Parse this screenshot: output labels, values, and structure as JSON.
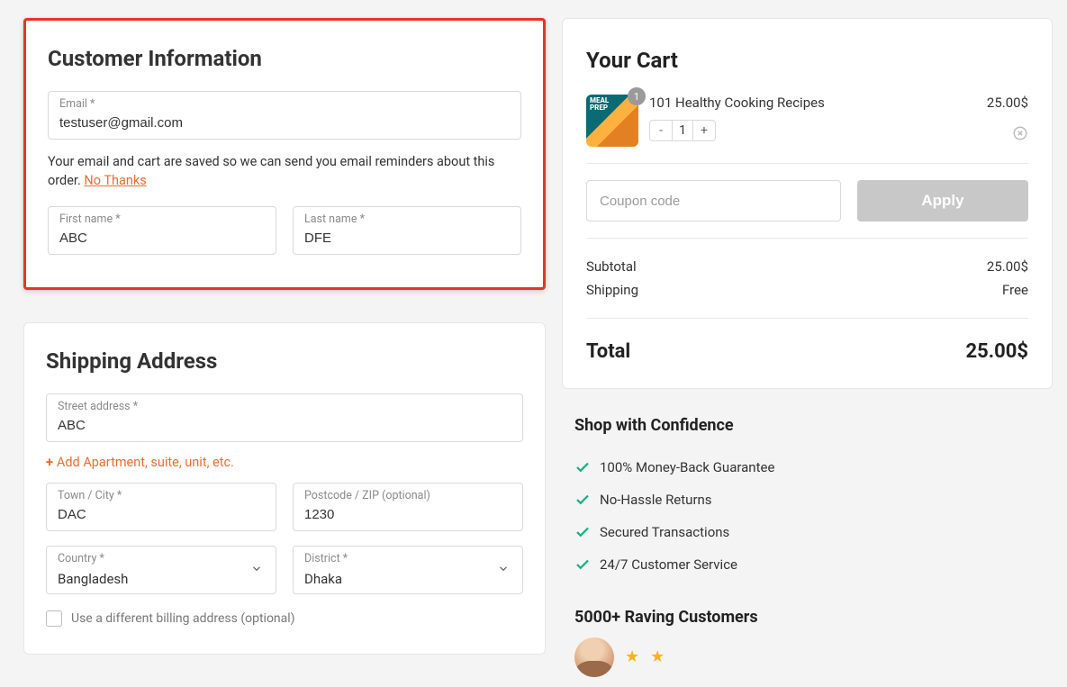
{
  "customer": {
    "heading": "Customer Information",
    "email": {
      "label": "Email *",
      "value": "testuser@gmail.com"
    },
    "note_prefix": "Your email and cart are saved so we can send you email reminders about this order. ",
    "note_link": "No Thanks",
    "first_name": {
      "label": "First name *",
      "value": "ABC"
    },
    "last_name": {
      "label": "Last name *",
      "value": "DFE"
    }
  },
  "shipping": {
    "heading": "Shipping Address",
    "street": {
      "label": "Street address *",
      "value": "ABC"
    },
    "add_apartment_label": "Add Apartment, suite, unit, etc.",
    "city": {
      "label": "Town / City *",
      "value": "DAC"
    },
    "postcode": {
      "label": "Postcode / ZIP (optional)",
      "value": "1230"
    },
    "country": {
      "label": "Country *",
      "value": "Bangladesh"
    },
    "district": {
      "label": "District *",
      "value": "Dhaka"
    },
    "diff_billing_label": "Use a different billing address (optional)"
  },
  "cart": {
    "heading": "Your Cart",
    "item": {
      "name": "101 Healthy Cooking Recipes",
      "price": "25.00$",
      "qty": "1",
      "badge": "1",
      "thumb_title_l1": "MEAL",
      "thumb_title_l2": "PREP"
    },
    "coupon_placeholder": "Coupon code",
    "apply_label": "Apply",
    "subtotal_label": "Subtotal",
    "subtotal_value": "25.00$",
    "shipping_label": "Shipping",
    "shipping_value": "Free",
    "total_label": "Total",
    "total_value": "25.00$"
  },
  "confidence": {
    "heading": "Shop with Confidence",
    "items": [
      "100% Money-Back Guarantee",
      "No-Hassle Returns",
      "Secured Transactions",
      "24/7 Customer Service"
    ]
  },
  "customers": {
    "heading": "5000+ Raving Customers"
  }
}
